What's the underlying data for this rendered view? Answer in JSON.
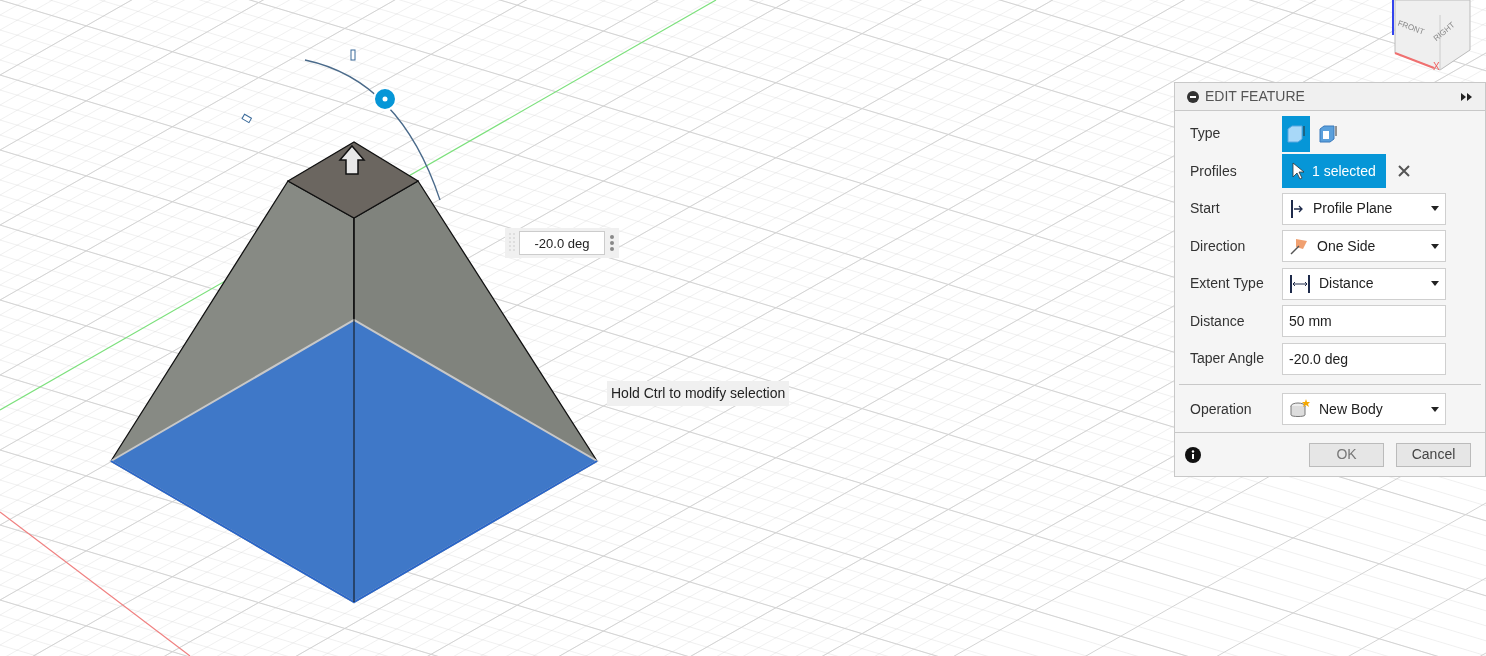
{
  "viewcube": {
    "faces": [
      "FRONT",
      "RIGHT"
    ],
    "axis_label": "X"
  },
  "angle_input": {
    "value": "-20.0 deg"
  },
  "tooltip": "Hold Ctrl to modify selection",
  "panel": {
    "title": "EDIT FEATURE",
    "rows": [
      {
        "kind": "type",
        "label": "Type",
        "options": [
          {
            "kind": "solid",
            "selected": true
          },
          {
            "kind": "thin",
            "selected": false
          }
        ]
      },
      {
        "kind": "selection",
        "label": "Profiles",
        "value": "1 selected"
      },
      {
        "kind": "dropdown",
        "label": "Start",
        "value": "Profile Plane"
      },
      {
        "kind": "dropdown",
        "label": "Direction",
        "value": "One Side"
      },
      {
        "kind": "dropdown",
        "label": "Extent Type",
        "value": "Distance"
      },
      {
        "kind": "input",
        "label": "Distance",
        "value": "50 mm"
      },
      {
        "kind": "input",
        "label": "Taper Angle",
        "value": "-20.0 deg"
      },
      {
        "kind": "divider"
      },
      {
        "kind": "dropdown",
        "label": "Operation",
        "value": "New Body"
      }
    ],
    "buttons": [
      "OK",
      "Cancel"
    ]
  }
}
